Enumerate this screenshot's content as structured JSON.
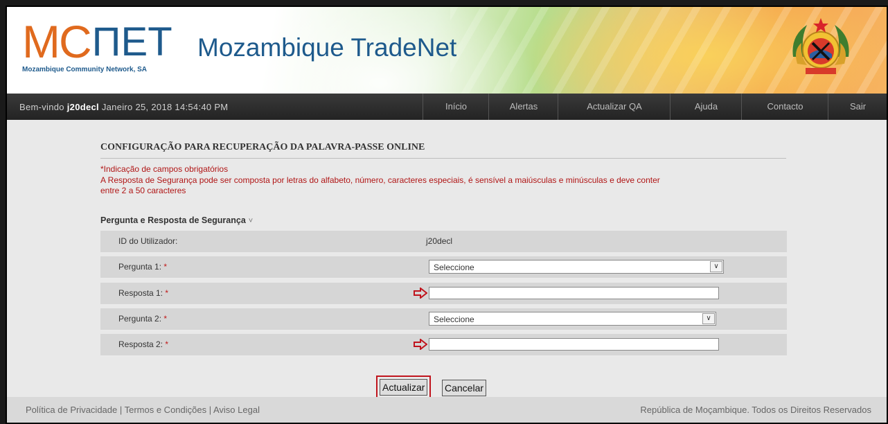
{
  "header": {
    "logo_mc": "MC",
    "logo_net": "ΠET",
    "logo_subtitle": "Mozambique Community Network, SA",
    "site_title": "Mozambique TradeNet",
    "emblem_icon": "mozambique-emblem-icon"
  },
  "navbar": {
    "welcome_prefix": "Bem-vindo ",
    "username": "j20decl",
    "datetime": " Janeiro 25, 2018 14:54:40 PM",
    "items": [
      {
        "label": "Início"
      },
      {
        "label": "Alertas"
      },
      {
        "label": "Actualizar QA"
      },
      {
        "label": "Ajuda"
      },
      {
        "label": "Contacto"
      },
      {
        "label": "Sair"
      }
    ]
  },
  "form": {
    "title": "CONFIGURAÇÃO PARA RECUPERAÇÃO DA PALAVRA-PASSE ONLINE",
    "required_note": "*Indicação de campos obrigatórios",
    "answer_note": "A Resposta de Segurança pode ser composta por letras do alfabeto, número, caracteres especiais, é sensível a maiúsculas e minúsculas e deve conter",
    "answer_note_2": "entre 2 a 50 caracteres",
    "section_title": "Pergunta e Resposta de Segurança",
    "section_chevron": "˅",
    "required_mark": "*",
    "user_id_label": "ID do Utilizador:",
    "user_id_value": "j20decl",
    "question1_label": "Pergunta 1:",
    "question1_value": "Seleccione",
    "answer1_label": "Resposta 1:",
    "answer1_value": "",
    "question2_label": "Pergunta 2:",
    "question2_value": "Seleccione",
    "answer2_label": "Resposta 2:",
    "answer2_value": "",
    "update_button": "Actualizar",
    "cancel_button": "Cancelar",
    "highlight_color": "#c0141d"
  },
  "footer": {
    "links": "Política de Privacidade | Termos e Condições | Aviso Legal",
    "rights": "República de Moçambique. Todos os Direitos Reservados"
  }
}
